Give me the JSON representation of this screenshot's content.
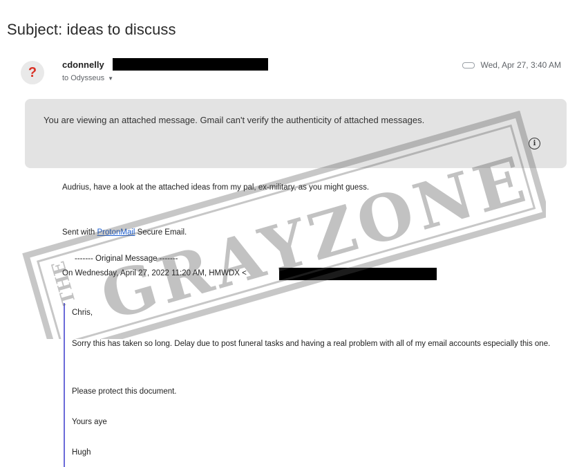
{
  "email": {
    "subject": "Subject: ideas to discuss",
    "avatar_glyph": "?",
    "sender": "cdonnelly",
    "to": "to Odysseus",
    "date": "Wed, Apr 27, 3:40 AM",
    "banner": "You are viewing an attached message. Gmail can't verify the authenticity of attached messages.",
    "intro": "Audrius, have a look at the attached ideas from my pal, ex-military, as you might guess.",
    "sent_prefix": "Sent with ",
    "sent_link": "ProtonMail",
    "sent_suffix": " Secure Email.",
    "original_header": "------- Original Message -------",
    "original_on": "On Wednesday, April 27, 2022 11:20 AM, HMWDX <",
    "quoted": {
      "greeting": "Chris,",
      "paragraph1": "Sorry this has taken so long.  Delay due to post funeral tasks and having a real problem with all of my email accounts especially this one.",
      "paragraph2": "Please protect this document.",
      "signoff": "Yours aye",
      "name": "Hugh"
    }
  },
  "watermark": {
    "the": "THE",
    "text": "GRAYZONE"
  },
  "icons": {
    "avatar": "unknown-sender-icon",
    "attachment": "attachment-icon",
    "info": "info-icon",
    "caret": "chevron-down-icon"
  },
  "colors": {
    "link": "#1a5ccf",
    "avatar_mark": "#d93025",
    "quote_bar": "#6a6ad8",
    "banner_bg": "#e3e3e3"
  }
}
